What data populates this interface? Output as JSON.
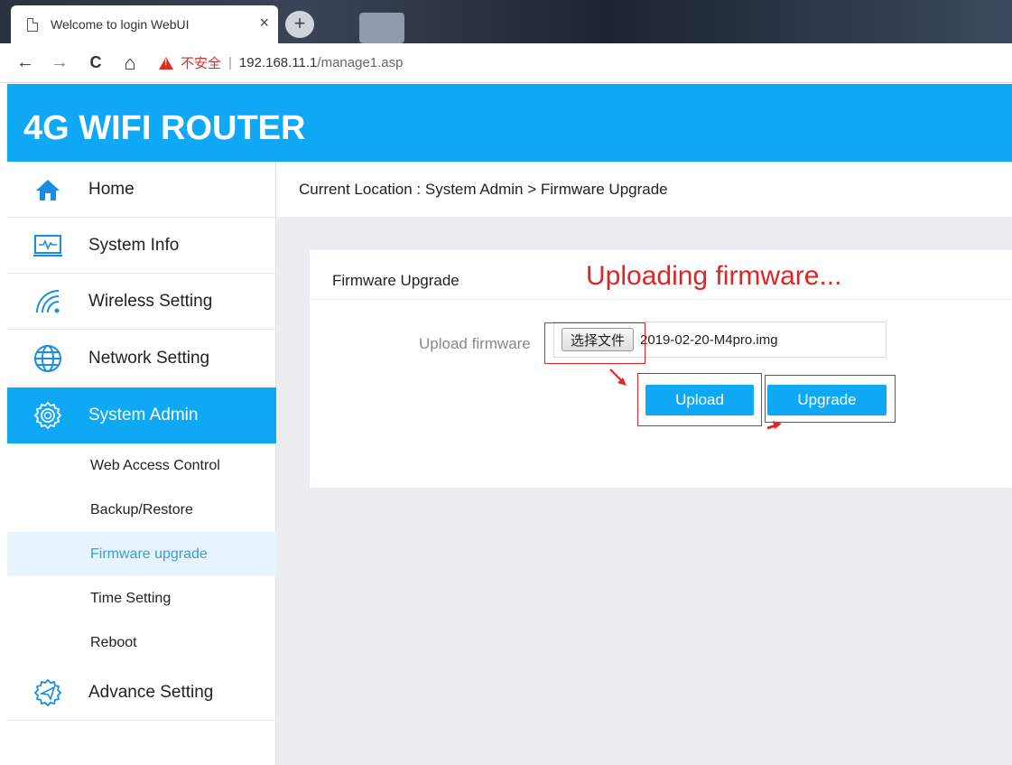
{
  "browser": {
    "tab_title": "Welcome to login WebUI",
    "tab_close": "×",
    "new_tab": "+",
    "back": "←",
    "forward": "→",
    "reload": "C",
    "home": "⌂",
    "insecure_label": "不安全",
    "separator": "|",
    "url_host": "192.168.11.1",
    "url_path": "/manage1.asp"
  },
  "header": {
    "title": "4G WIFI ROUTER"
  },
  "sidebar": {
    "items": [
      {
        "label": "Home",
        "icon": "home-icon"
      },
      {
        "label": "System Info",
        "icon": "monitor-icon"
      },
      {
        "label": "Wireless Setting",
        "icon": "wifi-icon"
      },
      {
        "label": "Network Setting",
        "icon": "globe-icon"
      },
      {
        "label": "System Admin",
        "icon": "gear-icon",
        "active": true
      },
      {
        "label": "Advance Setting",
        "icon": "settings-plane-icon"
      }
    ],
    "sub_items": [
      {
        "label": "Web Access Control"
      },
      {
        "label": "Backup/Restore"
      },
      {
        "label": "Firmware upgrade",
        "active": true
      },
      {
        "label": "Time Setting"
      },
      {
        "label": "Reboot"
      }
    ]
  },
  "breadcrumb": {
    "text": "Current Location : System Admin > Firmware Upgrade"
  },
  "panel": {
    "title": "Firmware Upgrade",
    "status": "Uploading firmware...",
    "field_label": "Upload firmware",
    "choose_file_label": "选择文件",
    "file_name": "2019-02-20-M4pro.img",
    "upload_label": "Upload",
    "upgrade_label": "Upgrade"
  },
  "colors": {
    "brand": "#0fa8f5",
    "annotation": "#e02424"
  }
}
